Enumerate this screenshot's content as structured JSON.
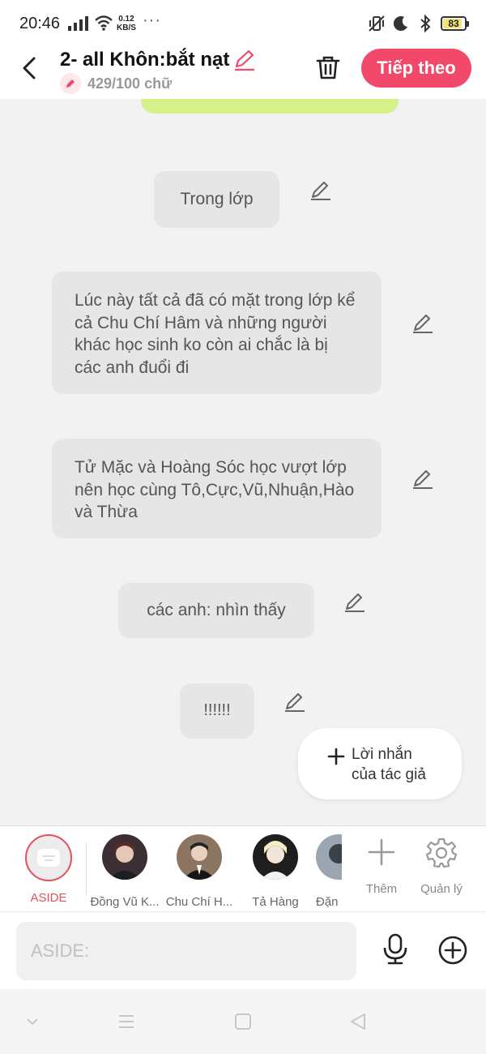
{
  "status": {
    "time": "20:46",
    "speed_value": "0.12",
    "speed_unit": "KB/S",
    "dots": "···",
    "battery": "83"
  },
  "header": {
    "title": "2- all Khôn:bắt nạt",
    "word_count": "429/100 chữ",
    "next_label": "Tiếp theo"
  },
  "messages": [
    {
      "text": "Trong lớp"
    },
    {
      "text": "Lúc này tất cả đã có mặt trong lớp kể cả Chu Chí Hâm và những người khác học sinh ko còn ai chắc là bị các anh đuổi đi"
    },
    {
      "text": "Tử Mặc và Hoàng Sóc học vượt lớp nên học cùng Tô,Cực,Vũ,Nhuận,Hào và Thừa"
    },
    {
      "text": "các anh: nhìn thấy"
    },
    {
      "text": "!!!!!!"
    }
  ],
  "author_note": {
    "line1": "Lời nhắn",
    "line2": "của tác giả"
  },
  "characters": [
    {
      "name": "ASIDE"
    },
    {
      "name": "Đồng Vũ K..."
    },
    {
      "name": "Chu Chí H..."
    },
    {
      "name": "Tả Hàng"
    },
    {
      "name": "Đặn"
    }
  ],
  "tools": {
    "add_label": "Thêm",
    "manage_label": "Quản lý"
  },
  "input": {
    "placeholder": "ASIDE:"
  },
  "colors": {
    "accent": "#f2486a",
    "aside_ring": "#e4515a",
    "green_strip": "#d6f08a"
  }
}
